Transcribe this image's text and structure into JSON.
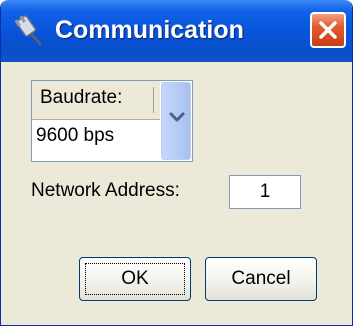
{
  "window": {
    "title": "Communication",
    "close_icon": "close-icon",
    "app_icon": "plug-cable-icon"
  },
  "baudrate": {
    "label": "Baudrate:",
    "selected_value": "9600 bps",
    "dropdown_icon": "chevron-down-icon"
  },
  "network": {
    "label": "Network Address:",
    "value": "1"
  },
  "buttons": {
    "ok_label": "OK",
    "cancel_label": "Cancel"
  },
  "colors": {
    "titlebar": "#0853d8",
    "close_button": "#e25a32",
    "dialog_background": "#ece9d8"
  }
}
